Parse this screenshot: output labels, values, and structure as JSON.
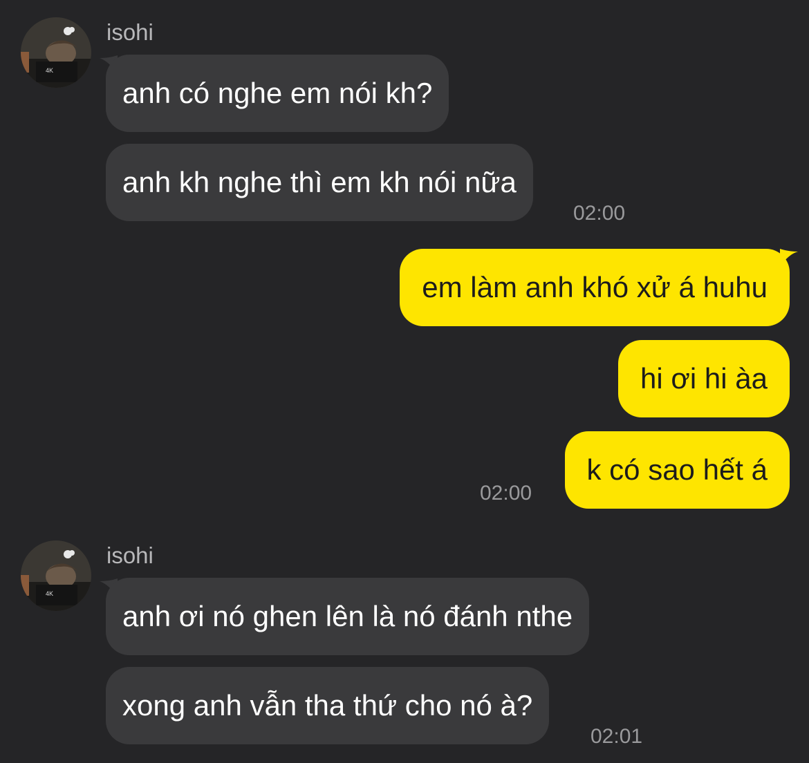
{
  "conversation": {
    "groups": [
      {
        "direction": "incoming",
        "sender": "isohi",
        "messages": [
          "anh có nghe em nói kh?",
          "anh kh nghe thì em kh nói nữa"
        ],
        "time": "02:00"
      },
      {
        "direction": "outgoing",
        "messages": [
          "em làm anh khó xử á huhu",
          "hi ơi hi àa",
          "k có sao hết á"
        ],
        "time": "02:00"
      },
      {
        "direction": "incoming",
        "sender": "isohi",
        "messages": [
          "anh ơi nó ghen lên là nó đánh nthe",
          "xong anh vẫn tha thứ cho nó à?"
        ],
        "time": "02:01"
      }
    ]
  },
  "colors": {
    "background": "#252527",
    "incoming_bubble": "#3a3a3c",
    "outgoing_bubble": "#fee500",
    "timestamp": "#9a9a9c"
  }
}
